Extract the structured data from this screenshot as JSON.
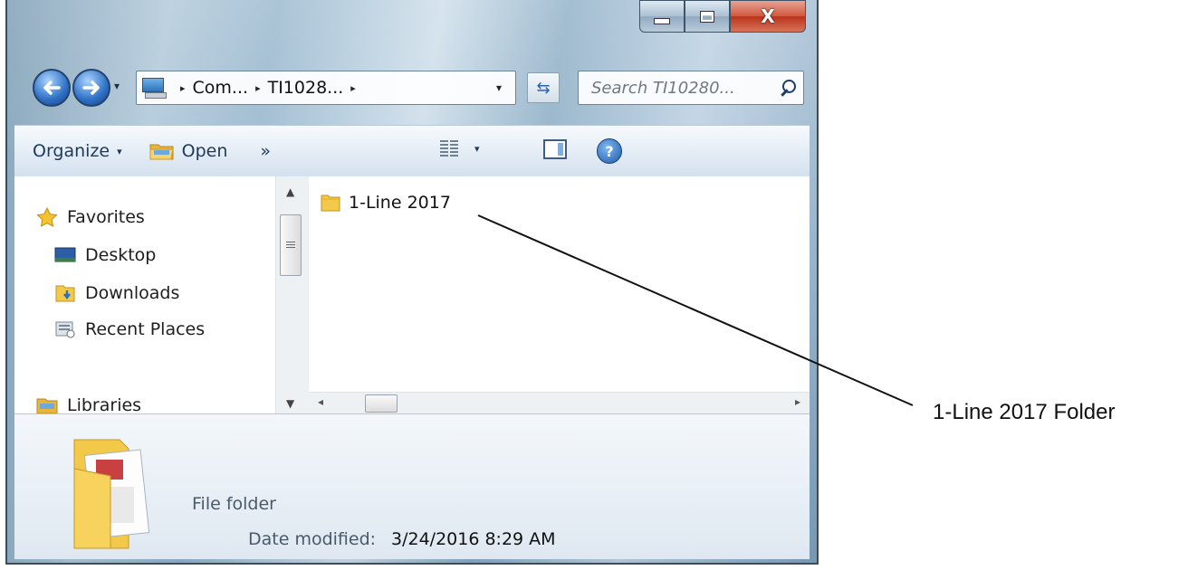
{
  "window": {
    "caption_buttons": {
      "minimize_icon": "minimize-icon",
      "maximize_icon": "maximize-icon",
      "close_label": "X"
    }
  },
  "navigation": {
    "back_icon": "back-arrow-icon",
    "forward_icon": "forward-arrow-icon",
    "breadcrumb": [
      "Com...",
      "TI1028..."
    ],
    "separator": "▸",
    "dropdown": "▾",
    "refresh_icon": "refresh-icon",
    "refresh_glyph": "⇆",
    "search_placeholder": "Search TI10280..."
  },
  "command_bar": {
    "organize": "Organize",
    "organize_caret": "▾",
    "open": "Open",
    "more": "»",
    "views_caret": "▾",
    "help": "?"
  },
  "nav_pane": {
    "items": [
      {
        "label": "Favorites",
        "icon": "star-icon"
      },
      {
        "label": "Desktop",
        "icon": "desktop-icon"
      },
      {
        "label": "Downloads",
        "icon": "downloads-folder-icon"
      },
      {
        "label": "Recent Places",
        "icon": "recent-places-icon"
      },
      {
        "label": "Libraries",
        "icon": "libraries-icon"
      }
    ]
  },
  "content": {
    "items": [
      {
        "name": "1-Line 2017",
        "icon": "folder-icon"
      }
    ]
  },
  "scrollbars": {
    "up": "▲",
    "down": "▼",
    "left": "◂",
    "right": "▸"
  },
  "details": {
    "type": "File folder",
    "date_modified_label": "Date modified:",
    "date_modified_value": "3/24/2016 8:29 AM"
  },
  "callout": {
    "text": "1-Line 2017 Folder"
  },
  "colors": {
    "title_glass": "#a9c3d6",
    "command_bar": "#e3ecf5",
    "close_button": "#cf5a3f",
    "folder_yellow": "#f3c94a",
    "link_blue": "#1e395b"
  }
}
